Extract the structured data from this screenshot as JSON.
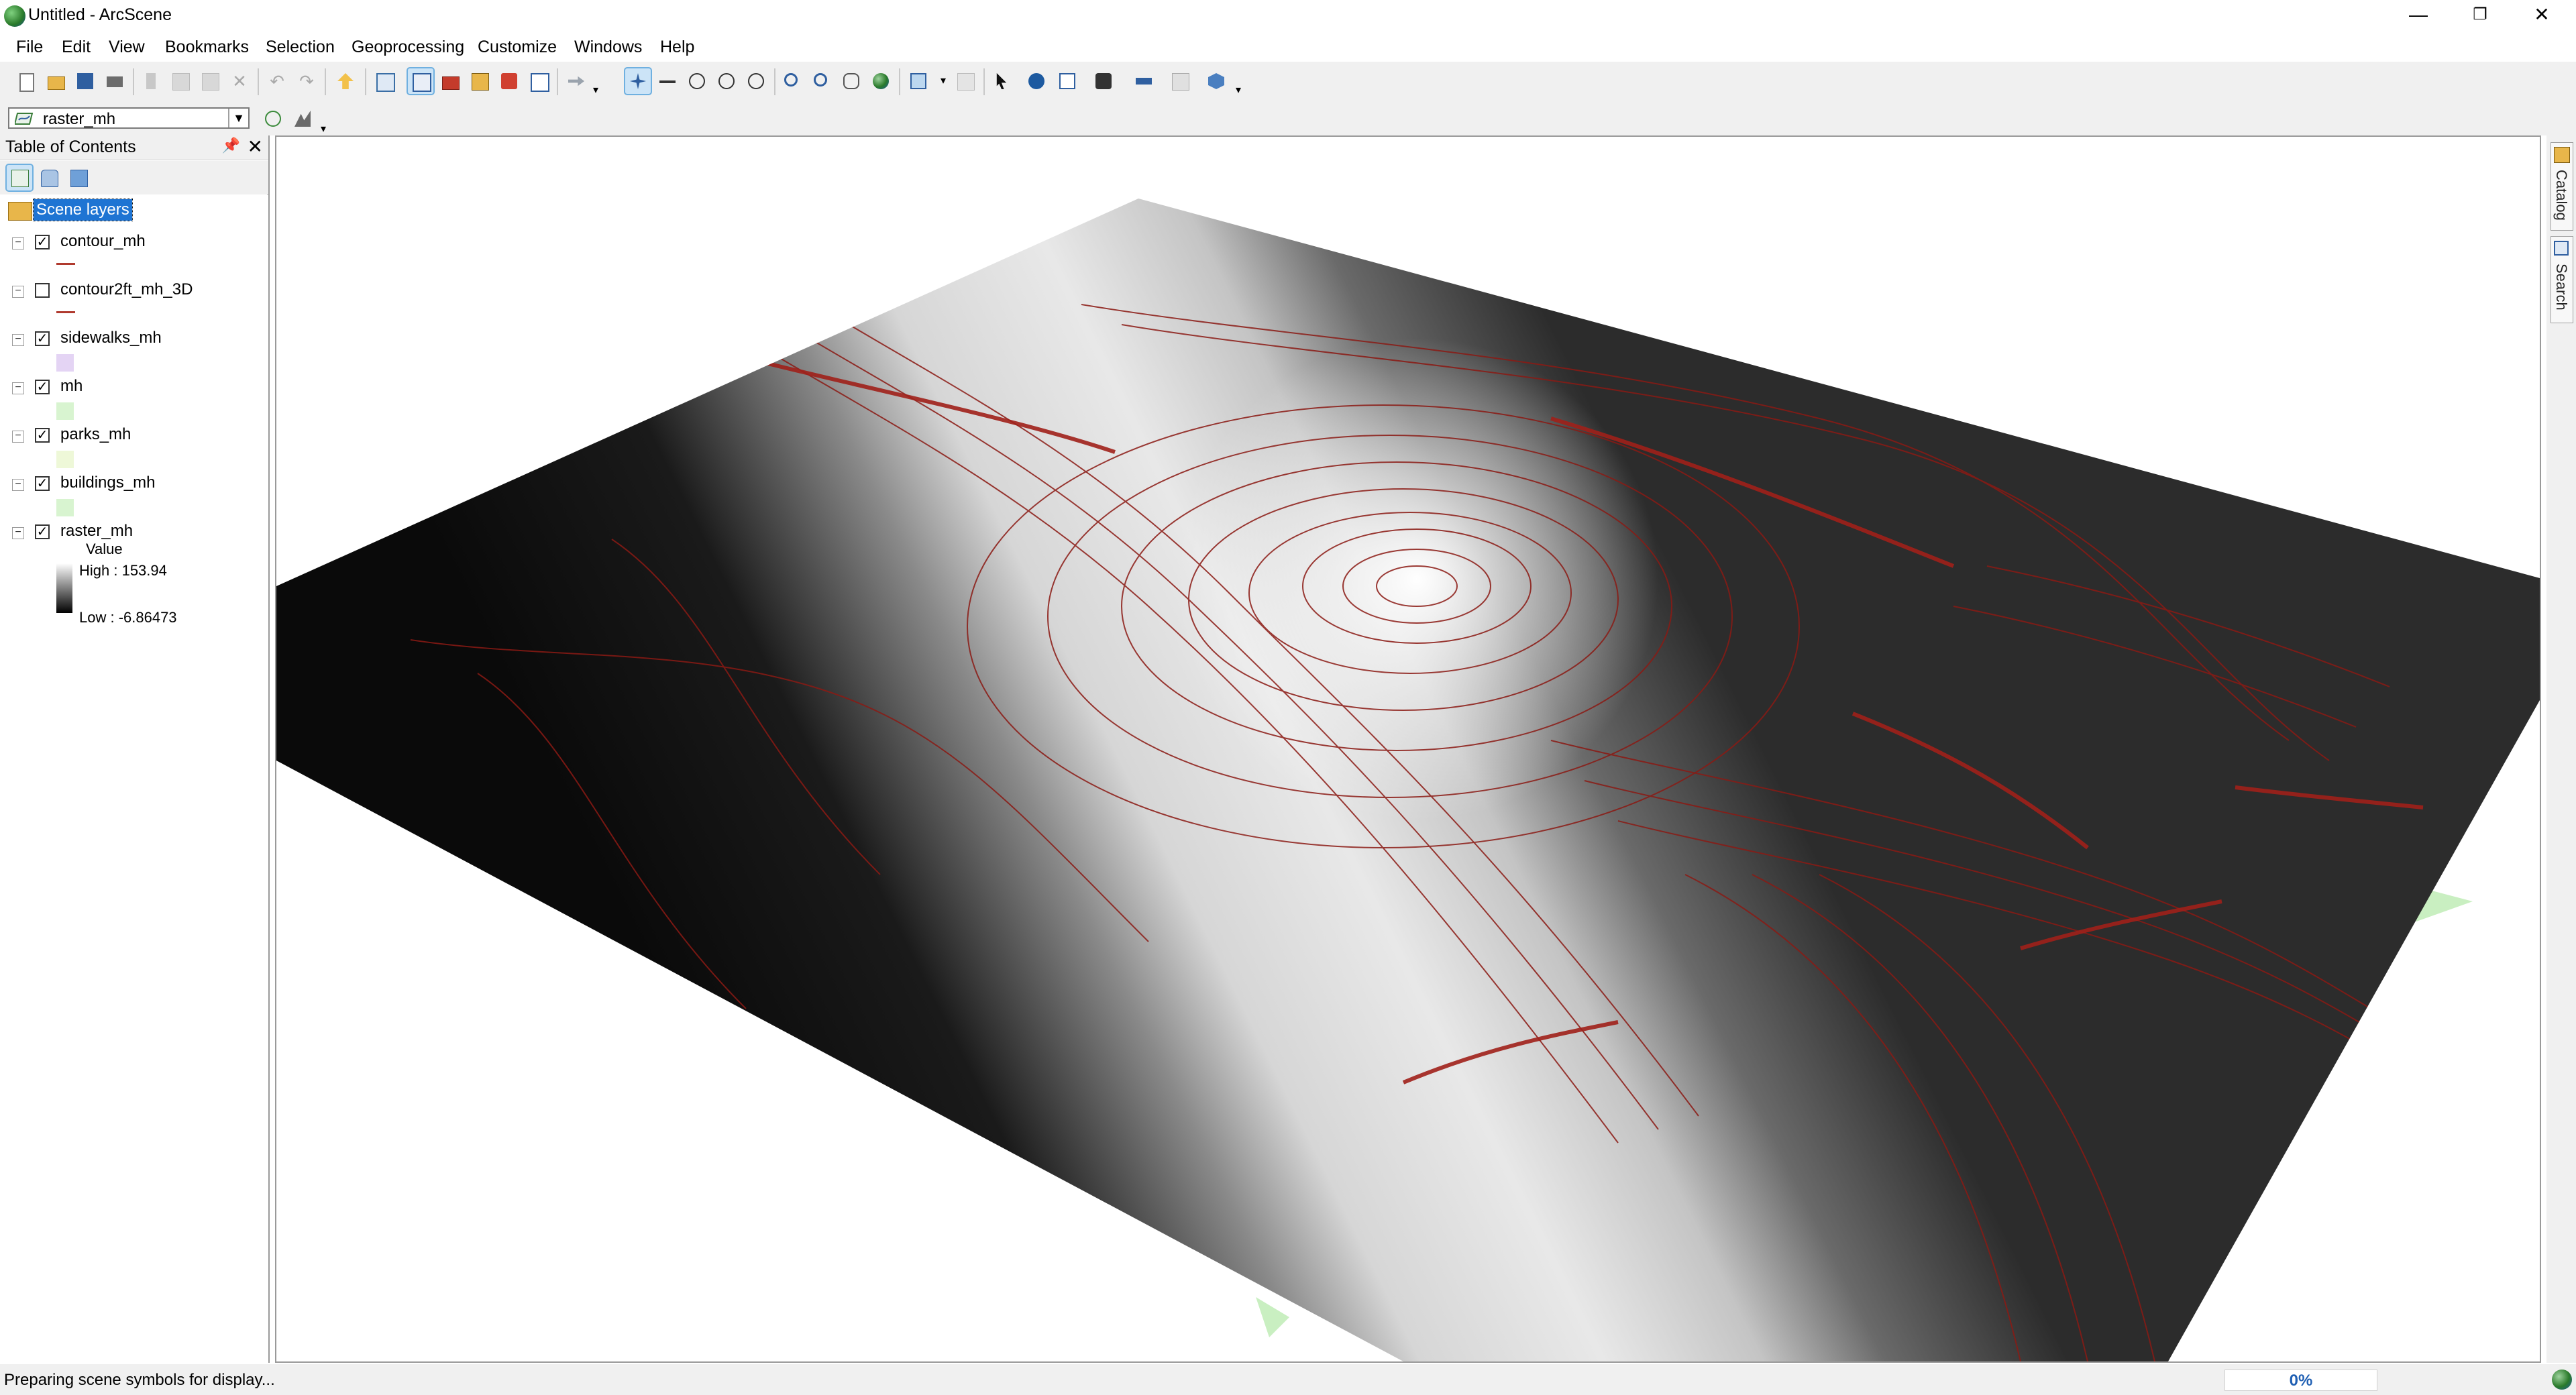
{
  "window": {
    "title": "Untitled - ArcScene",
    "minimize": "—",
    "restore": "❐",
    "close": "✕"
  },
  "menubar": {
    "items": [
      "File",
      "Edit",
      "View",
      "Bookmarks",
      "Selection",
      "Geoprocessing",
      "Customize",
      "Windows",
      "Help"
    ]
  },
  "toolbar": {
    "layer_dropdown": "raster_mh",
    "icons": [
      "new-document-icon",
      "open-icon",
      "save-icon",
      "print-icon",
      "cut-icon",
      "copy-icon",
      "paste-icon",
      "delete-icon",
      "undo-icon",
      "redo-icon",
      "add-data-icon",
      "scene-properties-icon",
      "toc-icon",
      "arctoolbox-icon",
      "catalog-icon",
      "python-icon",
      "model-builder-icon",
      "navigate-icon",
      "fly-icon",
      "target-center-icon",
      "zoom-to-target-icon",
      "set-observer-icon",
      "zoom-in-icon",
      "zoom-out-icon",
      "pan-icon",
      "full-extent-icon",
      "select-features-icon",
      "clear-selection-icon",
      "select-elements-icon",
      "identify-icon",
      "html-popup-icon",
      "find-icon",
      "measure-icon",
      "animation-icon",
      "3d-effects-icon"
    ]
  },
  "toc": {
    "title": "Table of Contents",
    "root_label": "Scene layers",
    "layers": [
      {
        "name": "contour_mh",
        "checked": true,
        "symbol": "line",
        "color": "#b03a2e"
      },
      {
        "name": "contour2ft_mh_3D",
        "checked": false,
        "symbol": "line",
        "color": "#b03a2e"
      },
      {
        "name": "sidewalks_mh",
        "checked": true,
        "symbol": "patch",
        "color": "#e4d4f4"
      },
      {
        "name": "mh",
        "checked": true,
        "symbol": "patch",
        "color": "#d8f4d0"
      },
      {
        "name": "parks_mh",
        "checked": true,
        "symbol": "patch",
        "color": "#eef8d8"
      },
      {
        "name": "buildings_mh",
        "checked": true,
        "symbol": "patch",
        "color": "#d8f4d0"
      },
      {
        "name": "raster_mh",
        "checked": true,
        "symbol": "ramp"
      }
    ],
    "legend": {
      "label": "Value",
      "high": "High : 153.94",
      "low": "Low : -6.86473"
    }
  },
  "dock": {
    "tabs": [
      "Catalog",
      "Search"
    ]
  },
  "status": {
    "message": "Preparing scene symbols for display...",
    "progress": "0%"
  },
  "colors": {
    "contour": "#8b1a14",
    "selection": "#1e74d3",
    "progress_text": "#1f5fb3"
  }
}
